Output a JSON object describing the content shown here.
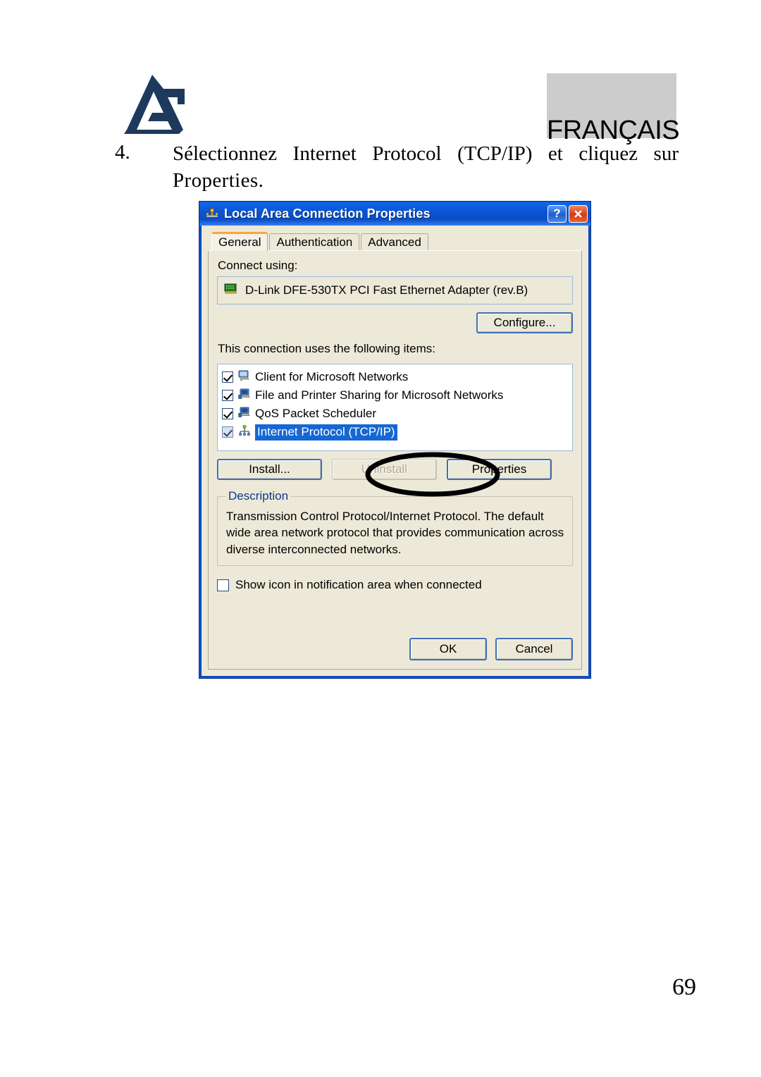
{
  "page": {
    "language_banner": "FRANÇAIS",
    "logo_name": "atlantis-land-logo",
    "page_number": "69"
  },
  "instruction": {
    "number": "4.",
    "line1_words": [
      "Sélectionnez",
      "Internet",
      "Protocol",
      "(TCP/IP)",
      "et",
      "cliquez",
      "sur"
    ],
    "line2": "Properties."
  },
  "dialog": {
    "title": "Local Area Connection Properties",
    "titlebar_icon": "network-connection-icon",
    "help_button": "?",
    "close_button": "×",
    "tabs": [
      {
        "label": "General",
        "active": true
      },
      {
        "label": "Authentication",
        "active": false
      },
      {
        "label": "Advanced",
        "active": false
      }
    ],
    "connect_using_label": "Connect using:",
    "adapter": {
      "icon": "network-adapter-card-icon",
      "name": "D-Link DFE-530TX PCI Fast Ethernet Adapter (rev.B)"
    },
    "configure_button": "Configure...",
    "items_label": "This connection uses the following items:",
    "items": [
      {
        "label": "Client for Microsoft Networks",
        "checked": true,
        "selected": false,
        "icon": "client-network-icon"
      },
      {
        "label": "File and Printer Sharing for Microsoft Networks",
        "checked": true,
        "selected": false,
        "icon": "file-print-sharing-icon"
      },
      {
        "label": "QoS Packet Scheduler",
        "checked": true,
        "selected": false,
        "icon": "qos-scheduler-icon"
      },
      {
        "label": "Internet Protocol (TCP/IP)",
        "checked": true,
        "selected": true,
        "icon": "protocol-icon"
      }
    ],
    "install_button": "Install...",
    "uninstall_button": "Uninstall",
    "properties_button": "Properties",
    "annotation": "ellipse-highlight-properties",
    "description_legend": "Description",
    "description_text": "Transmission Control Protocol/Internet Protocol. The default wide area network protocol that provides communication across diverse interconnected networks.",
    "show_icon_label": "Show icon in notification area when connected",
    "show_icon_checked": false,
    "ok_button": "OK",
    "cancel_button": "Cancel"
  },
  "colors": {
    "titlebar_blue": "#0a55d4",
    "dialog_face": "#ece9d8",
    "selection_blue": "#1567d3",
    "banner_grey": "#cccccc",
    "logo_navy": "#1d3a5c",
    "active_tab_accent": "#f7a838",
    "legend_blue": "#0b3c8c"
  }
}
